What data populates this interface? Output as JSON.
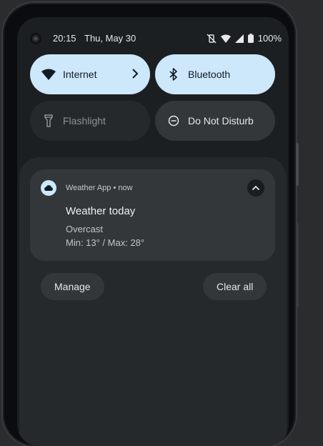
{
  "status_bar": {
    "time": "20:15",
    "date": "Thu, May 30",
    "battery": "100%",
    "icons": [
      "vibrate-off-icon",
      "wifi-icon",
      "signal-icon",
      "battery-icon"
    ]
  },
  "quick_settings": {
    "tiles": [
      {
        "label": "Internet",
        "icon": "wifi-icon",
        "state": "on",
        "has_chevron": true
      },
      {
        "label": "Bluetooth",
        "icon": "bluetooth-icon",
        "state": "on"
      },
      {
        "label": "Flashlight",
        "icon": "flashlight-icon",
        "state": "off"
      },
      {
        "label": "Do Not Disturb",
        "icon": "do-not-disturb-icon",
        "state": "off"
      }
    ]
  },
  "notification": {
    "app_name": "Weather App",
    "separator": "•",
    "time": "now",
    "title": "Weather today",
    "line1": "Overcast",
    "line2": "Min: 13° / Max: 28°",
    "icon": "cloud-icon"
  },
  "actions": {
    "manage": "Manage",
    "clear_all": "Clear all"
  },
  "colors": {
    "tile_on": "#cde7fb",
    "tile_off": "#25292c",
    "shade": "#25292c",
    "card": "#33373a"
  }
}
